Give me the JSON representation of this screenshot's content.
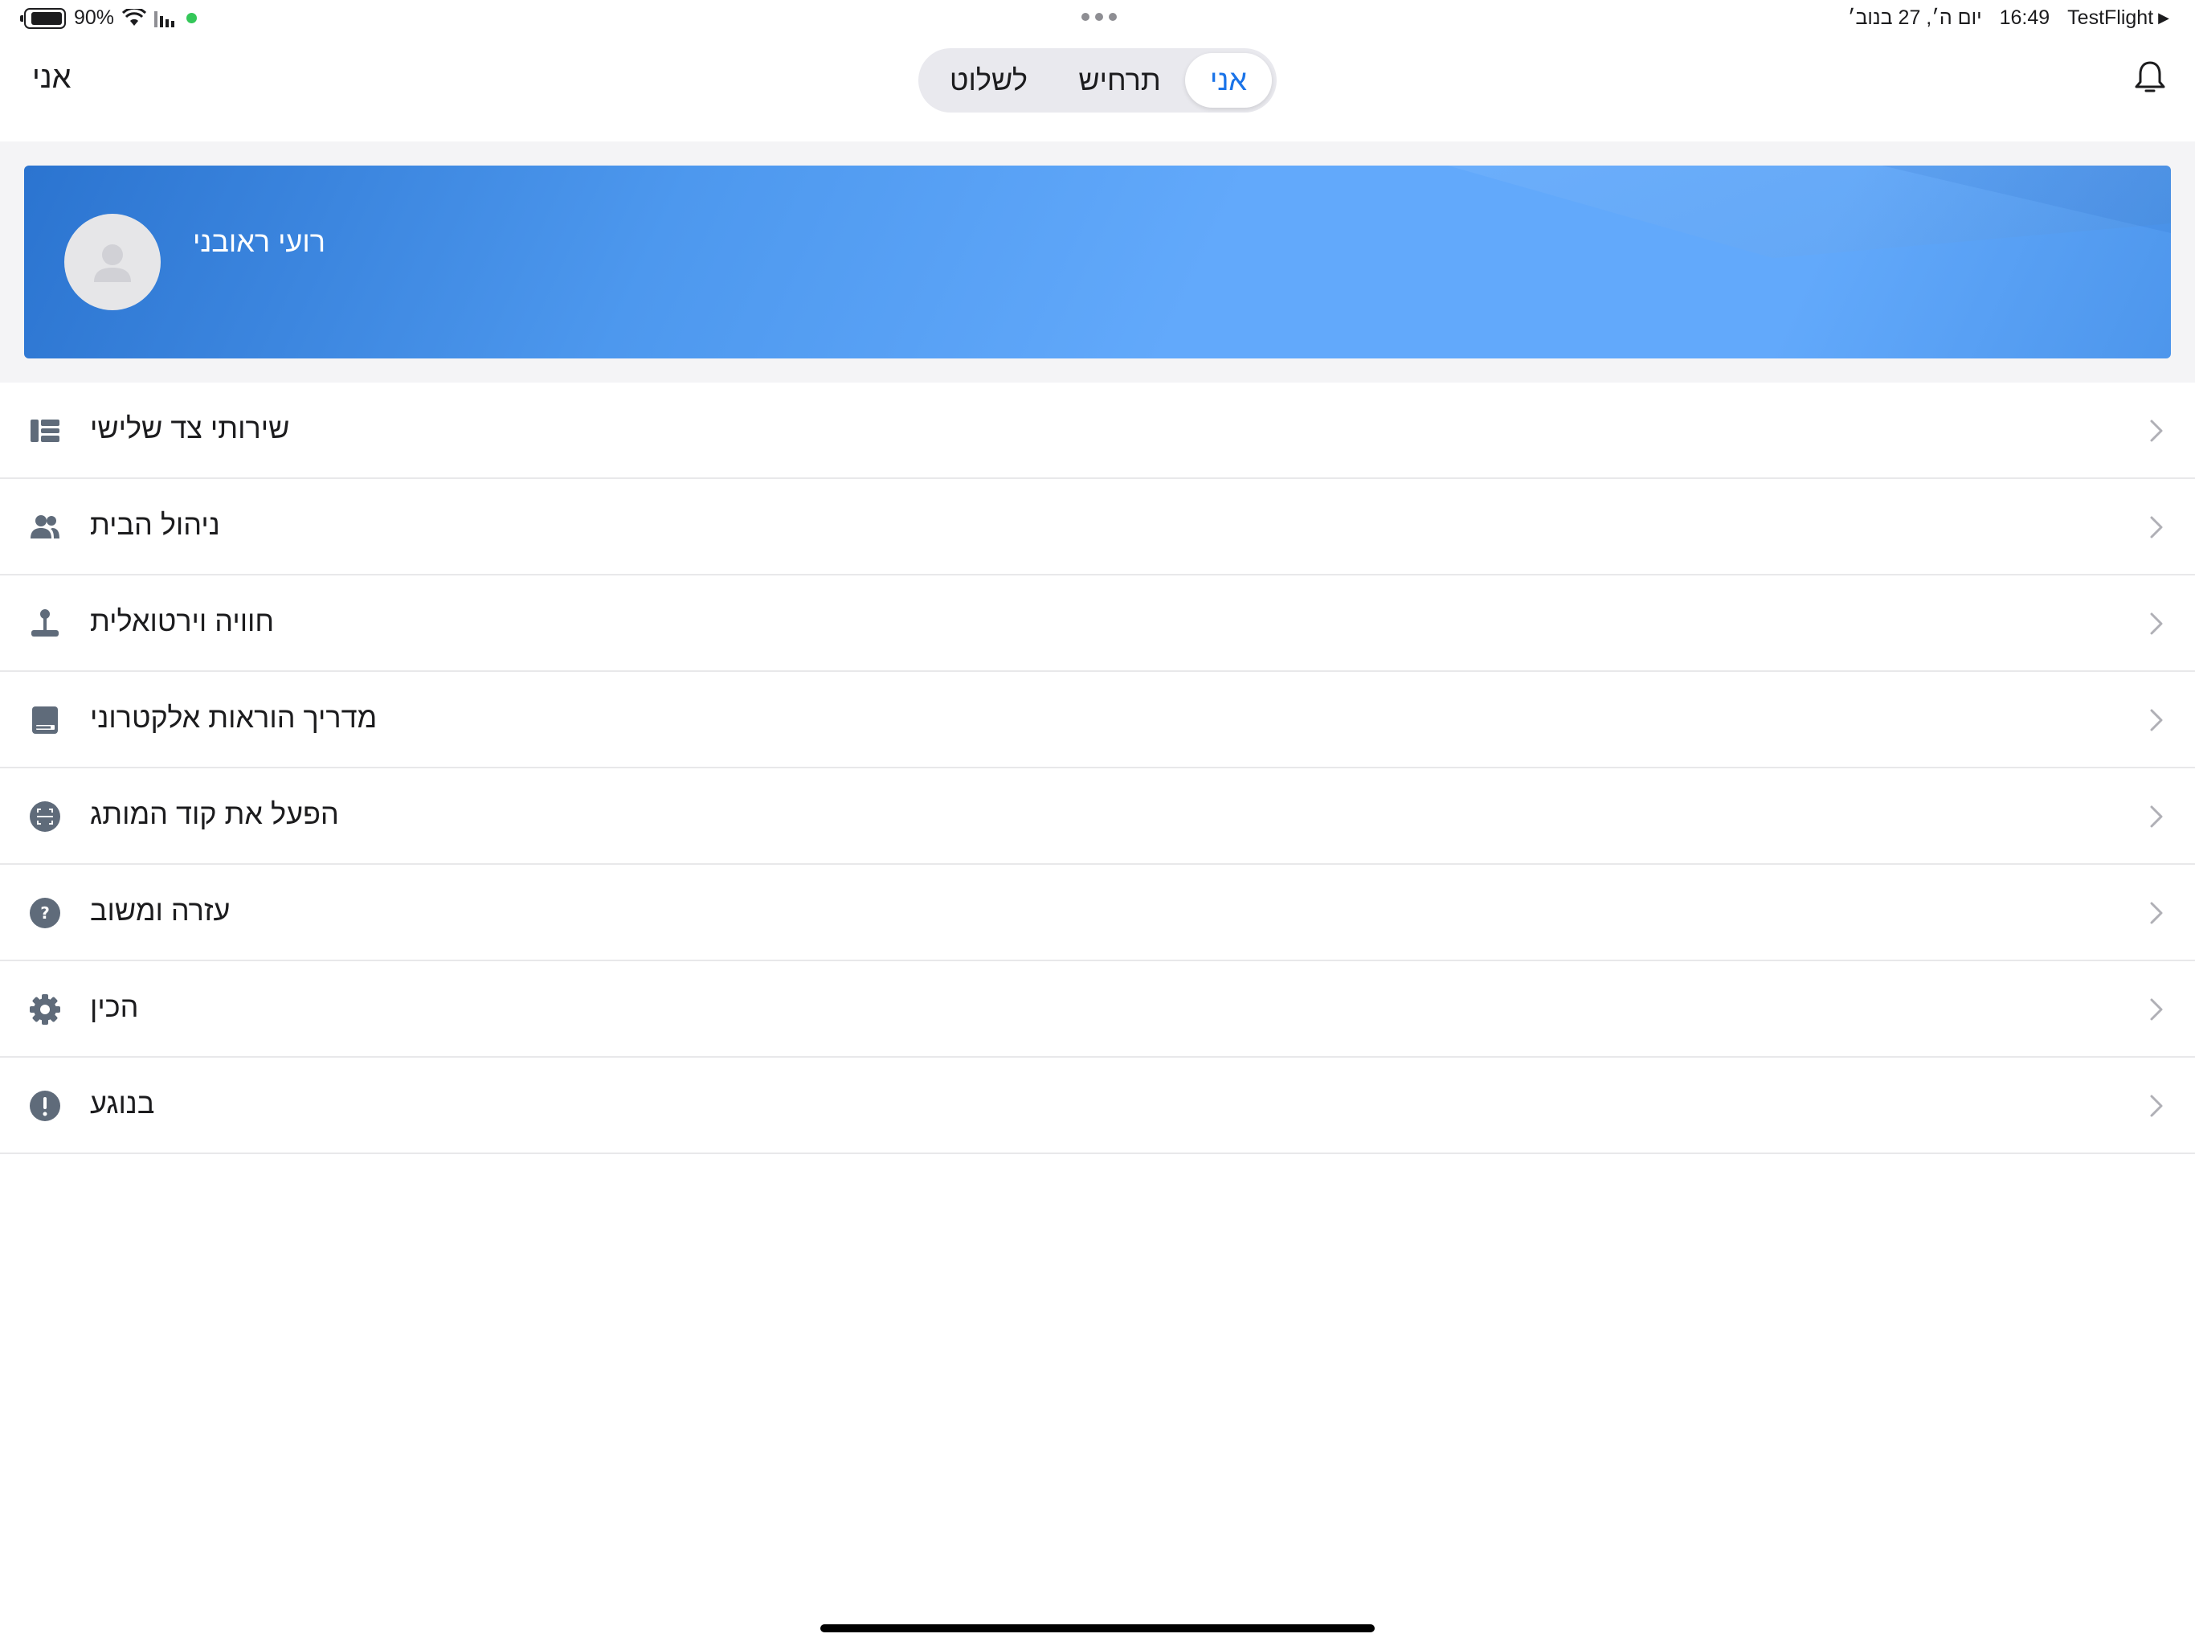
{
  "status_bar": {
    "battery": "90%",
    "app": "TestFlight",
    "time": "16:49",
    "date": "יום ה׳, 27 בנוב׳"
  },
  "nav": {
    "title": "אני",
    "tabs": [
      {
        "label": "אני",
        "active": true
      },
      {
        "label": "תרחיש",
        "active": false
      },
      {
        "label": "לשלוט",
        "active": false
      }
    ]
  },
  "profile": {
    "name": "רועי ראובני"
  },
  "menu": {
    "items": [
      {
        "label": "שירותי צד שלישי",
        "icon": "list-icon"
      },
      {
        "label": "ניהול הבית",
        "icon": "people-icon"
      },
      {
        "label": "חוויה וירטואלית",
        "icon": "joystick-icon"
      },
      {
        "label": "מדריך הוראות אלקטרוני",
        "icon": "book-icon"
      },
      {
        "label": "הפעל את קוד המותג",
        "icon": "scan-code-icon"
      },
      {
        "label": "עזרה ומשוב",
        "icon": "help-icon"
      },
      {
        "label": "הכין",
        "icon": "gear-icon"
      },
      {
        "label": "בנוגע",
        "icon": "info-icon"
      }
    ]
  },
  "colors": {
    "accent": "#1a73e8",
    "icon_gray": "#5f6b7a",
    "card_blue": "#62a9fb"
  }
}
